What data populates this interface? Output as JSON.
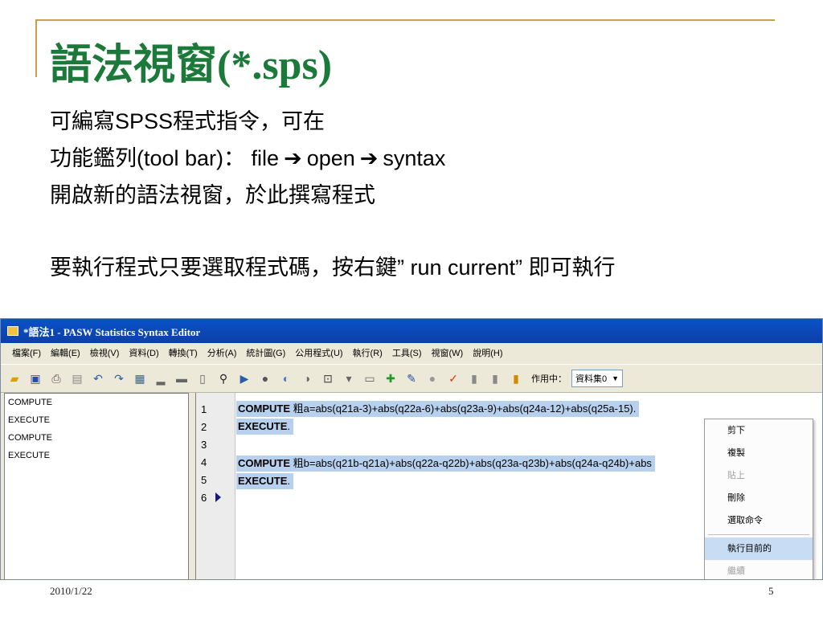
{
  "title": "語法視窗(*.sps)",
  "bullets": {
    "line1": "可編寫SPSS程式指令，可在",
    "line2_a": "功能鑑列(tool bar)：  file",
    "line2_b": "open",
    "line2_c": "syntax",
    "line3": "開啟新的語法視窗，於此撰寫程式",
    "line4": "要執行程式只要選取程式碼，按右鍵” run current” 即可執行"
  },
  "window": {
    "title": "*語法1 - PASW Statistics Syntax Editor",
    "menus": [
      "檔案(F)",
      "編輯(E)",
      "檢視(V)",
      "資料(D)",
      "轉換(T)",
      "分析(A)",
      "統計圖(G)",
      "公用程式(U)",
      "執行(R)",
      "工具(S)",
      "視窗(W)",
      "說明(H)"
    ],
    "toolbar": {
      "active_label": "作用中：",
      "dataset": "資料集0"
    },
    "nav_items": [
      "COMPUTE",
      "EXECUTE",
      "COMPUTE",
      "EXECUTE"
    ],
    "line_numbers": [
      "1",
      "2",
      "3",
      "4",
      "5",
      "6"
    ],
    "code": {
      "l1_kw": "COMPUTE",
      "l1_rest": "粗a=abs(q21a-3)+abs(q22a-6)+abs(q23a-9)+abs(q24a-12)+abs(q25a-15).",
      "l2_kw": "EXECUTE",
      "l2_rest": ".",
      "l4_kw": "COMPUTE",
      "l4_rest": "粗b=abs(q21b-q21a)+abs(q22a-q22b)+abs(q23a-q23b)+abs(q24a-q24b)+abs",
      "l5_kw": "EXECUTE",
      "l5_rest": "."
    },
    "context_menu": [
      "剪下",
      "複製",
      "貼上",
      "刪除",
      "選取命令",
      "執行目前的",
      "繼續"
    ]
  },
  "footer": {
    "date": "2010/1/22",
    "page": "5"
  },
  "colors": {
    "title": "#1b7a3a",
    "rule": "#c8a24a",
    "selection": "#b6d0ee"
  }
}
